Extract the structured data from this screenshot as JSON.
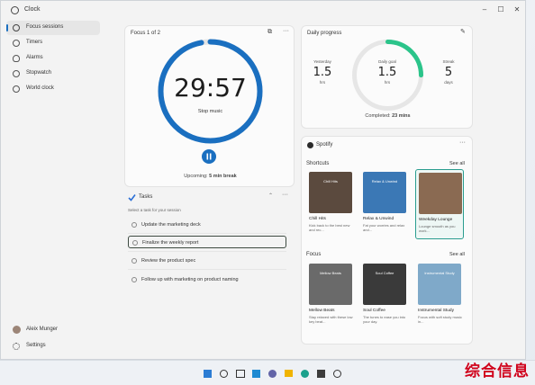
{
  "window": {
    "title": "Clock"
  },
  "sidebar": {
    "items": [
      {
        "label": "Focus sessions",
        "icon": "focus-icon",
        "active": true
      },
      {
        "label": "Timers",
        "icon": "timer-icon"
      },
      {
        "label": "Alarms",
        "icon": "alarm-icon"
      },
      {
        "label": "Stopwatch",
        "icon": "stopwatch-icon"
      },
      {
        "label": "World clock",
        "icon": "globe-icon"
      }
    ],
    "account": "Aleix Munger",
    "settings": "Settings"
  },
  "focus": {
    "title": "Focus 1 of 2",
    "time": "29:57",
    "stop_label": "Stop music",
    "upcoming_prefix": "Upcoming:",
    "upcoming_value": "5 min break",
    "progress": 0.97,
    "accent": "#1a6fc0"
  },
  "tasks": {
    "title": "Tasks",
    "hint": "Select a task for your session",
    "items": [
      {
        "label": "Update the marketing deck"
      },
      {
        "label": "Finalize the weekly report",
        "selected": true
      },
      {
        "label": "Review the product spec"
      },
      {
        "label": "Follow up with marketing on product naming"
      }
    ]
  },
  "daily_progress": {
    "title": "Daily progress",
    "yesterday": {
      "label": "Yesterday",
      "value": "1.5",
      "unit": "hrs"
    },
    "goal": {
      "label": "Daily goal",
      "value": "1.5",
      "unit": "hrs"
    },
    "streak": {
      "label": "Streak",
      "value": "5",
      "unit": "days"
    },
    "completed_prefix": "Completed:",
    "completed_value": "23 mins",
    "progress": 0.25,
    "accent": "#2bc48a"
  },
  "spotify": {
    "title": "Spotify",
    "shortcuts_title": "Shortcuts",
    "focus_title": "Focus",
    "see_all": "See all",
    "shortcuts": [
      {
        "name": "Chill Hits",
        "desc": "Kick back to the best new and rec...",
        "caption": "Chill Hits",
        "color": "#5b4a3e"
      },
      {
        "name": "Relax & Unwind",
        "desc": "Fat your worries and relax and...",
        "caption": "Relax & Unwind",
        "color": "#3b78b5"
      },
      {
        "name": "Weekday Lounge",
        "desc": "Lounge smooth as you work...",
        "caption": "",
        "color": "#8a6a52",
        "selected": true
      }
    ],
    "focus": [
      {
        "name": "Mellow Beats",
        "desc": "Stay relaxed with these low key beat...",
        "caption": "Mellow Beats",
        "color": "#6a6a6a"
      },
      {
        "name": "Soul Coffee",
        "desc": "The tunes to ease you into your day.",
        "caption": "Soul Coffee",
        "color": "#3a3a3a"
      },
      {
        "name": "Instrumental Study",
        "desc": "Focus with soft study music in...",
        "caption": "Instrumental Study",
        "color": "#7fa9c9"
      }
    ]
  },
  "watermark": "综合信息"
}
